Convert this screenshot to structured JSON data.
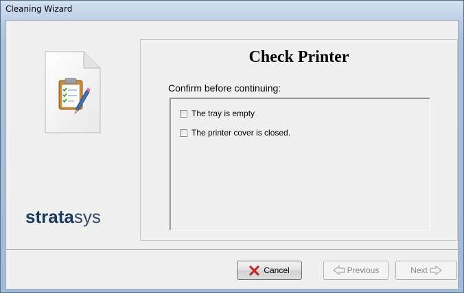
{
  "window": {
    "title": "Cleaning Wizard"
  },
  "sidebar": {
    "icon": "clipboard-checklist-icon",
    "brand_bold": "strata",
    "brand_light": "sys"
  },
  "main": {
    "title": "Check Printer",
    "instruction": "Confirm before continuing:",
    "checklist": [
      {
        "label": "The tray is empty",
        "checked": false
      },
      {
        "label": "The printer cover is closed.",
        "checked": false
      }
    ]
  },
  "buttons": {
    "cancel": {
      "label": "Cancel",
      "icon": "red-x-icon",
      "enabled": true
    },
    "previous": {
      "label": "Previous",
      "icon": "left-arrow-icon",
      "enabled": false
    },
    "next": {
      "label": "Next",
      "icon": "right-arrow-icon",
      "enabled": false
    }
  },
  "colors": {
    "cancel_icon": "#c0282a",
    "brand": "#1a3a60"
  }
}
